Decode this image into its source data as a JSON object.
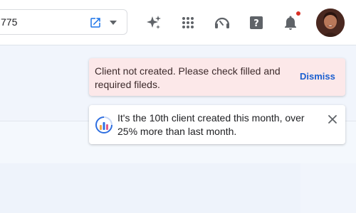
{
  "search": {
    "value": "775"
  },
  "toasts": {
    "error": {
      "message": "Client not created. Please check filled and required fileds.",
      "action_label": "Dismiss"
    },
    "info": {
      "message": "It's the 10th client created this month, over 25% more than last month."
    }
  },
  "icons": {
    "open": "open-in-new-icon",
    "caret": "caret-down-icon",
    "sparkle": "sparkle-icon",
    "apps": "apps-grid-icon",
    "support": "headset-icon",
    "help": "help-icon",
    "notifications": "bell-icon",
    "chart": "bar-chart-icon",
    "close": "close-icon"
  },
  "colors": {
    "accent": "#1a5fd0",
    "error_bg": "#fce8e9",
    "notification_dot": "#d93025"
  }
}
